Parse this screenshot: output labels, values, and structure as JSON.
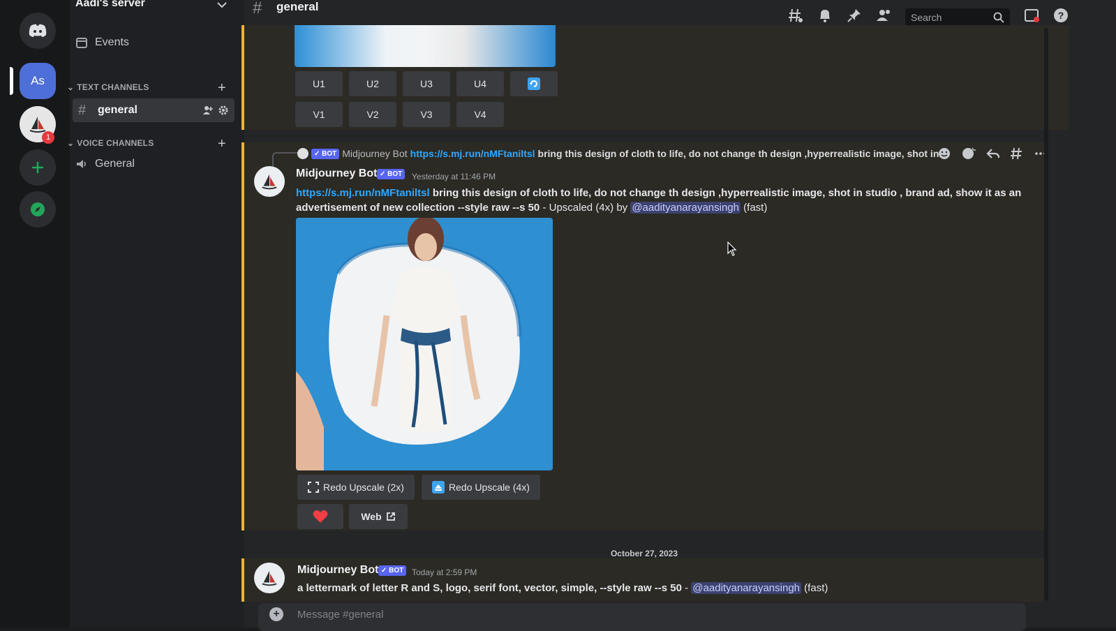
{
  "rail": {
    "server_abbrev": "As",
    "notification_count": "1"
  },
  "sidebar": {
    "server_name": "Aadi's server",
    "events_label": "Events",
    "text_category": "TEXT CHANNELS",
    "text_channel": "general",
    "voice_category": "VOICE CHANNELS",
    "voice_channel": "General"
  },
  "header": {
    "channel": "general",
    "search_placeholder": "Search"
  },
  "msg1": {
    "upscale_buttons": [
      "U1",
      "U2",
      "U3",
      "U4"
    ],
    "variation_buttons": [
      "V1",
      "V2",
      "V3",
      "V4"
    ]
  },
  "msg2": {
    "reply_badge": "✓ BOT",
    "reply_author": "Midjourney Bot",
    "reply_link": "https://s.mj.run/nMFtaniltsl",
    "reply_text": "bring this design of cloth to life, do not change th design ,hyperrealistic image, shot in",
    "author": "Midjourney Bot",
    "badge": "✓ BOT",
    "timestamp": "Yesterday at 11:46 PM",
    "link": "https://s.mj.run/nMFtaniltsl",
    "prompt_bold": " bring this design of cloth to life, do not change th design ,hyperrealistic image, shot in studio , brand ad, show it as an advertisement of new collection --style raw --s 50",
    "suffix": " - Upscaled (4x) by ",
    "mention": "@aadityanarayansingh",
    "speed": " (fast)",
    "redo2x": "Redo Upscale (2x)",
    "redo4x": "Redo Upscale (4x)",
    "web": "Web"
  },
  "divider_date": "October 27, 2023",
  "msg3": {
    "author": "Midjourney Bot",
    "badge": "✓ BOT",
    "timestamp": "Today at 2:59 PM",
    "prompt_bold": "a lettermark of letter R and S, logo, serif font, vector, simple, --style raw --s 50",
    "sep": " - ",
    "mention": "@aadityanarayansingh",
    "speed": " (fast)"
  },
  "composer": {
    "placeholder": "Message #general"
  },
  "colors": {
    "accent": "#5865f2",
    "highlight_border": "#f0b232",
    "link": "#2ea8ff"
  }
}
